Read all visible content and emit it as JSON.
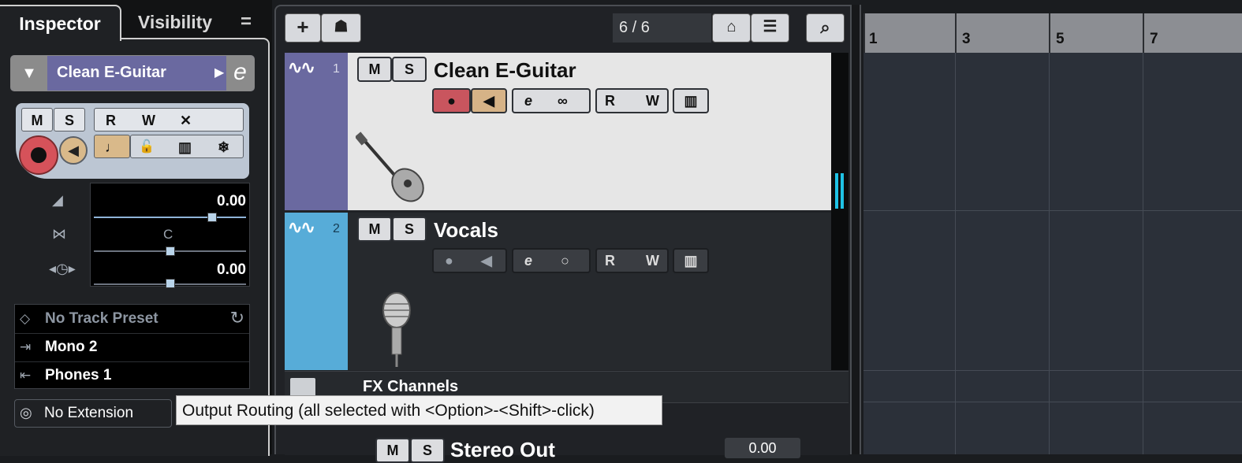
{
  "inspector": {
    "tabs": [
      "Inspector",
      "Visibility"
    ],
    "menu_glyph": "=",
    "track_name": "Clean E-Guitar",
    "ctrl": {
      "mute": "M",
      "solo": "S",
      "read": "R",
      "write": "W"
    },
    "volume_value": "0.00",
    "pan_center_label": "C",
    "delay_value": "0.00",
    "track_preset": "No Track Preset",
    "input_routing": "Mono 2",
    "output_routing": "Phones 1",
    "extension": "No Extension"
  },
  "toolbar": {
    "add_glyph": "+",
    "counter": "6 / 6"
  },
  "tracks": [
    {
      "number": "1",
      "name": "Clean E-Guitar",
      "color": "#6a69a0",
      "selected": true
    },
    {
      "number": "2",
      "name": "Vocals",
      "color": "#57acd8",
      "selected": false
    }
  ],
  "track_buttons": {
    "mute": "M",
    "solo": "S",
    "read": "R",
    "write": "W"
  },
  "fx_channels_label": "FX Channels",
  "stereo_out_label": "Stereo Out",
  "stereo_out_value": "0.00",
  "ruler_labels": [
    "1",
    "3",
    "5",
    "7"
  ],
  "tooltip": "Output Routing (all selected with <Option>-<Shift>-click)"
}
